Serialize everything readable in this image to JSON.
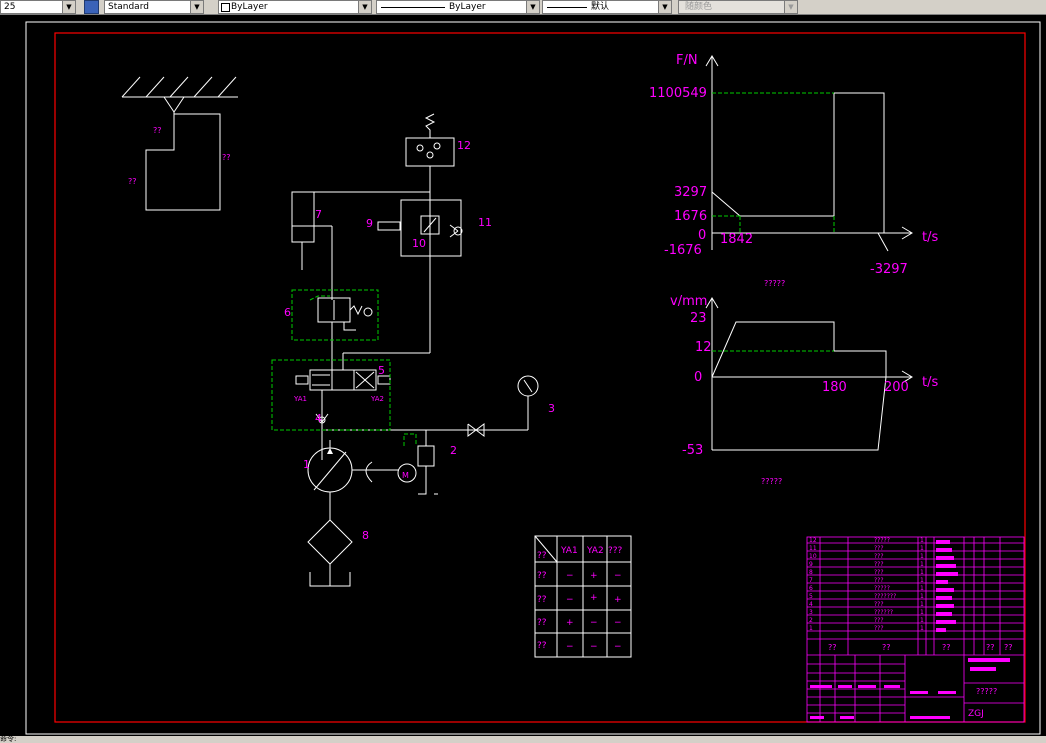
{
  "toolbar": {
    "scale": "25",
    "text_style": "Standard",
    "layer_color": "ByLayer",
    "linetype": "ByLayer",
    "lineweight": "默认",
    "plot_style": "随颜色"
  },
  "status_text": "命令:",
  "colors": {
    "background": "#000000",
    "frame": "#ff0000",
    "annotation": "#ff00ff",
    "pilot_line": "#00cc00",
    "drawing": "#ffffff"
  },
  "circuit": {
    "labels": [
      "1",
      "2",
      "3",
      "4",
      "5",
      "6",
      "7",
      "8",
      "9",
      "10",
      "11",
      "12"
    ],
    "solenoid_left": "YA1",
    "solenoid_right": "YA2",
    "motor": "M"
  },
  "workpiece": {
    "label_a": "??",
    "label_b": "??",
    "label_c": "??"
  },
  "force_chart": {
    "y_axis_label": "F/N",
    "x_axis_label": "t/s",
    "y_ticks": [
      "1100549",
      "3297",
      "1676",
      "0",
      "-1676"
    ],
    "x_tick": "1842",
    "neg_label": "-3297",
    "caption": "?????"
  },
  "velocity_chart": {
    "y_axis_label": "v/mm",
    "x_axis_label": "t/s",
    "y_ticks": [
      "23",
      "12",
      "0",
      "-53"
    ],
    "x_ticks": [
      "180",
      "200"
    ],
    "caption": "?????"
  },
  "action_table": {
    "headers": [
      "??",
      "YA1",
      "YA2",
      "???"
    ],
    "rows": [
      [
        "??",
        "−",
        "+",
        "−"
      ],
      [
        "??",
        "−",
        "+",
        "+"
      ],
      [
        "??",
        "+",
        "−",
        "−"
      ],
      [
        "??",
        "−",
        "−",
        "−"
      ]
    ]
  },
  "title_block": {
    "row_numbers": [
      "12",
      "11",
      "10",
      "9",
      "8",
      "7",
      "6",
      "5",
      "4",
      "3",
      "2",
      "1"
    ],
    "names": [
      "?????",
      "???",
      "???",
      "???",
      "???",
      "???",
      "?????",
      "???????",
      "???",
      "??????",
      "???",
      "???"
    ],
    "footer_labels": [
      "??",
      "??",
      "??",
      "??",
      "??"
    ],
    "drawing_title": "?????",
    "drawing_code": "ZGJ"
  }
}
